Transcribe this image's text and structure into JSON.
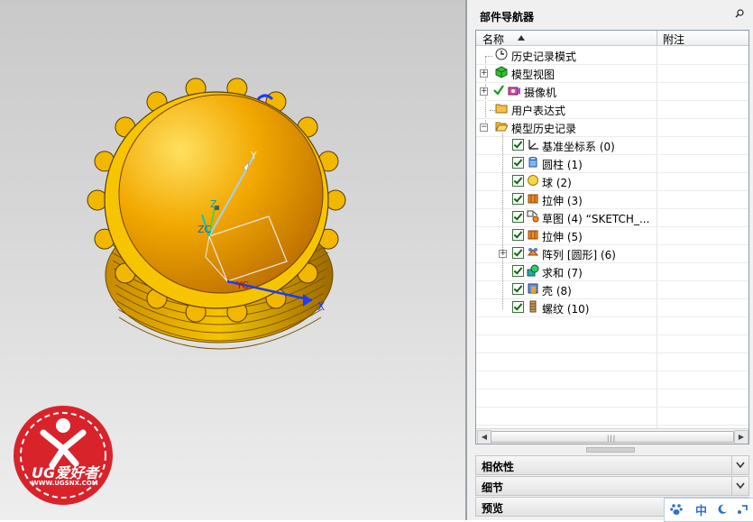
{
  "navigator": {
    "title": "部件导航器",
    "col_name": "名称",
    "col_note": "附注",
    "items": [
      {
        "label": "历史记录模式",
        "icon": "clock-icon"
      },
      {
        "label": "模型视图",
        "icon": "model-view-icon"
      },
      {
        "label": "摄像机",
        "icon": "camera-icon"
      },
      {
        "label": "用户表达式",
        "icon": "folder-icon"
      },
      {
        "label": "模型历史记录",
        "icon": "open-folder-icon"
      },
      {
        "label": "基准坐标系 (0)",
        "icon": "datum-csys-icon"
      },
      {
        "label": "圆柱 (1)",
        "icon": "cylinder-icon"
      },
      {
        "label": "球 (2)",
        "icon": "sphere-icon"
      },
      {
        "label": "拉伸 (3)",
        "icon": "extrude-icon"
      },
      {
        "label": "草图 (4) “SKETCH_...",
        "icon": "sketch-icon"
      },
      {
        "label": "拉伸 (5)",
        "icon": "extrude-icon"
      },
      {
        "label": "阵列 [圆形] (6)",
        "icon": "pattern-icon"
      },
      {
        "label": "求和 (7)",
        "icon": "unite-icon"
      },
      {
        "label": "壳 (8)",
        "icon": "shell-icon"
      },
      {
        "label": "螺纹 (10)",
        "icon": "thread-icon"
      }
    ],
    "sections": [
      "相依性",
      "细节",
      "预览"
    ]
  },
  "viewport": {
    "axis_labels": {
      "y": "Y",
      "z": "Z",
      "x": "X",
      "zc": "ZC",
      "yc": "YC"
    },
    "logo_text": "UG爱好者",
    "logo_url": "WWW.UGSNX.COM"
  },
  "ime": {
    "mode": "中"
  },
  "colors": {
    "part": "#f2a800",
    "accent": "#2f6fd0",
    "logo": "#d9232b"
  }
}
